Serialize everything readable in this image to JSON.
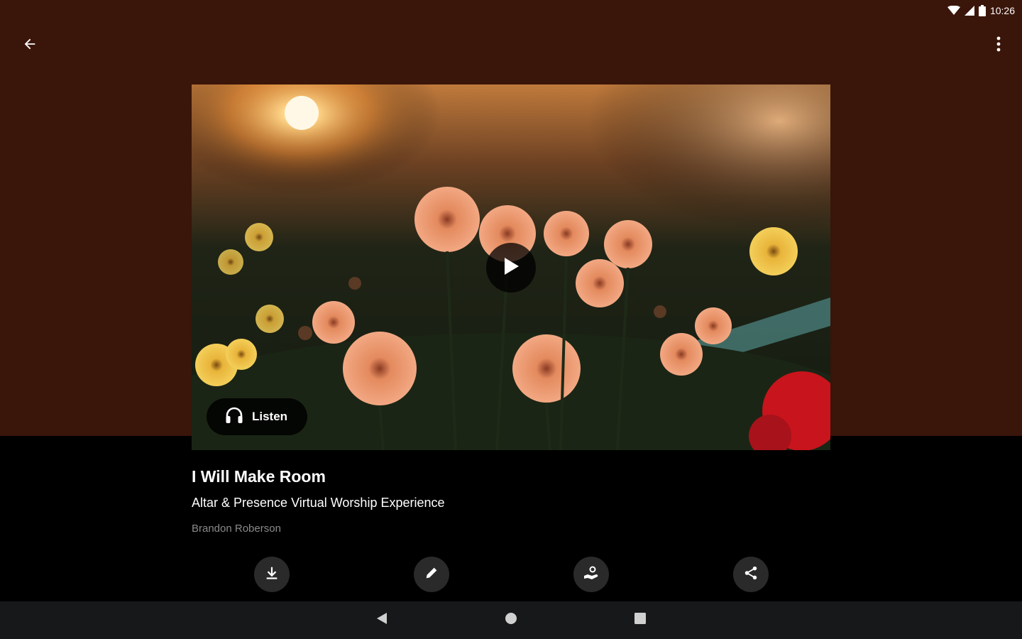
{
  "status_bar": {
    "time": "10:26",
    "icons": [
      "wifi-icon",
      "signal-icon",
      "battery-icon"
    ]
  },
  "app_bar": {
    "back_icon": "arrow-left-icon",
    "menu_icon": "more-vertical-icon"
  },
  "media": {
    "play_icon": "play-icon",
    "listen_label": "Listen",
    "listen_icon": "headphones-icon"
  },
  "content": {
    "title": "I Will Make Room",
    "subtitle": "Altar & Presence Virtual Worship Experience",
    "author": "Brandon Roberson"
  },
  "actions": [
    {
      "icon": "download-icon"
    },
    {
      "icon": "pencil-icon"
    },
    {
      "icon": "give-hand-icon"
    },
    {
      "icon": "share-icon"
    }
  ],
  "nav_bar": {
    "icons": [
      "nav-back-icon",
      "nav-home-icon",
      "nav-recents-icon"
    ]
  },
  "colors": {
    "header_bg": "#3a1509",
    "body_bg": "#000000",
    "nav_bg": "#16181a",
    "author_text": "#8a8a8a"
  }
}
